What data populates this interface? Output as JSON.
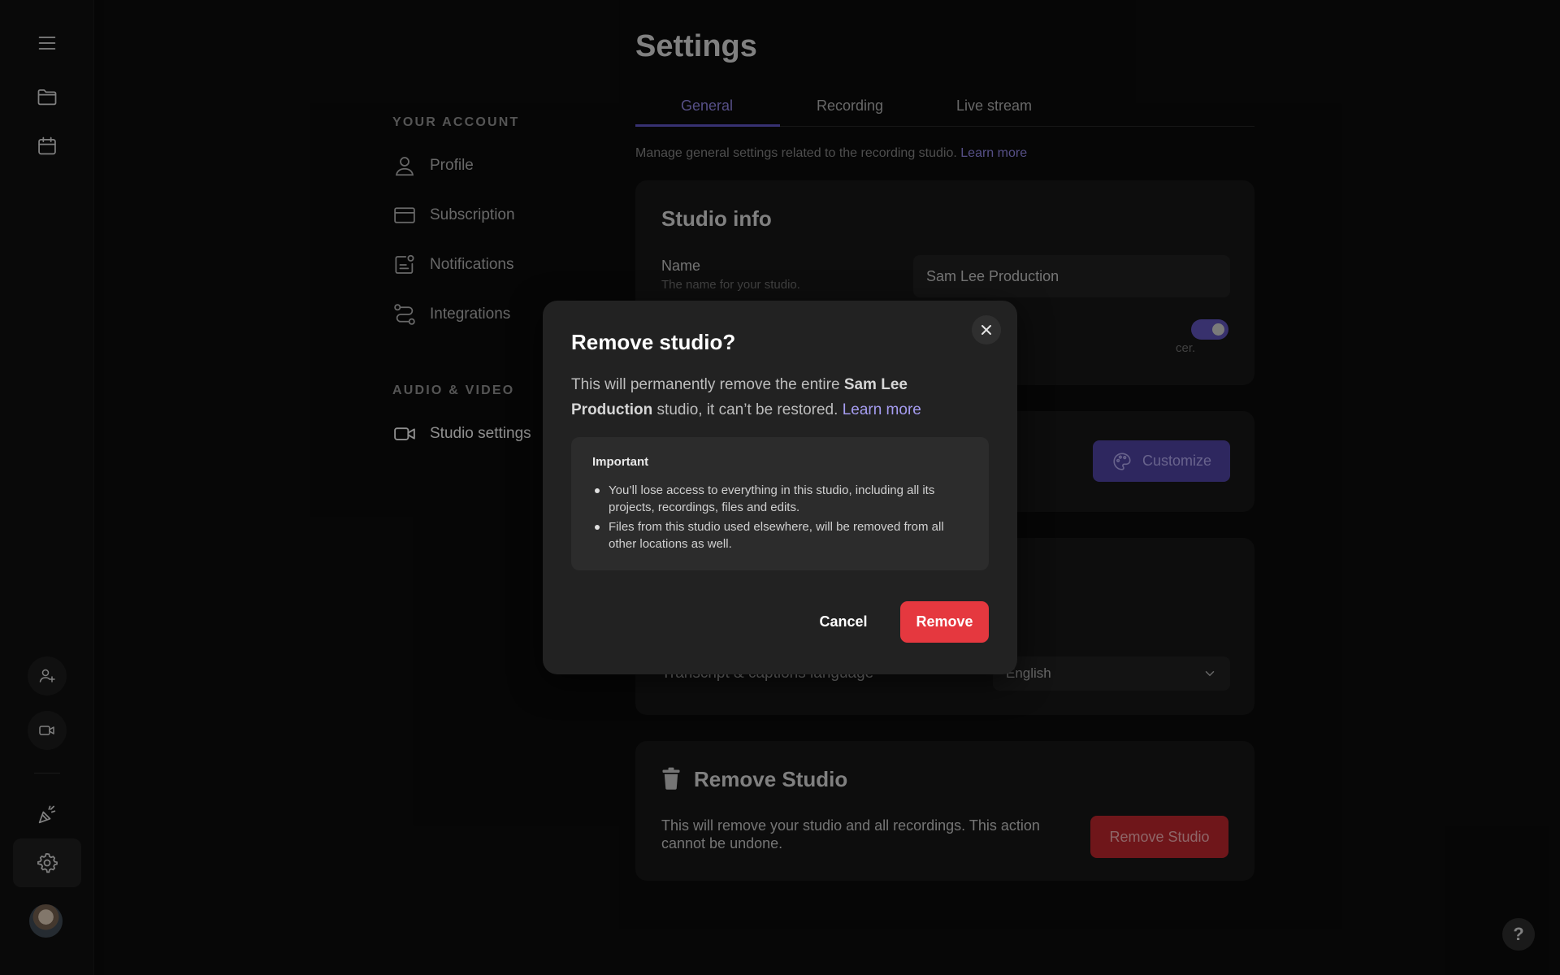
{
  "rail": {
    "icons": [
      "menu-icon",
      "folder-icon",
      "calendar-icon",
      "add-user-icon",
      "video-camera-icon",
      "celebration-icon",
      "gear-icon"
    ]
  },
  "sidebar": {
    "account_heading": "YOUR ACCOUNT",
    "account_items": [
      {
        "label": "Profile",
        "icon": "user-icon"
      },
      {
        "label": "Subscription",
        "icon": "credit-card-icon"
      },
      {
        "label": "Notifications",
        "icon": "notification-icon"
      },
      {
        "label": "Integrations",
        "icon": "integrations-icon"
      }
    ],
    "av_heading": "AUDIO & VIDEO",
    "av_items": [
      {
        "label": "Studio settings",
        "icon": "video-camera-icon"
      }
    ]
  },
  "main": {
    "title": "Settings",
    "tabs": [
      {
        "label": "General",
        "active": true
      },
      {
        "label": "Recording",
        "active": false
      },
      {
        "label": "Live stream",
        "active": false
      }
    ],
    "tab_description": "Manage general settings related to the recording studio.",
    "tab_description_link": "Learn more",
    "studio_info": {
      "title": "Studio info",
      "name_label": "Name",
      "name_sub": "The name for your studio.",
      "name_value": "Sam Lee Production",
      "toggle_sub_partial": "cer.",
      "toggle_on": true
    },
    "customize_label": "Customize",
    "language": {
      "label": "Transcript & captions language",
      "value": "English"
    },
    "remove_section": {
      "title": "Remove Studio",
      "description": "This will remove your studio and all recordings. This action cannot be undone.",
      "button": "Remove Studio"
    }
  },
  "help_label": "?",
  "modal": {
    "title": "Remove studio?",
    "body_before": "This will permanently remove the entire ",
    "body_bold": "Sam Lee Production",
    "body_after": " studio, it can’t be restored. ",
    "body_link": "Learn more",
    "important_title": "Important",
    "important_items": [
      "You’ll lose access to everything in this studio, including all its projects, recordings, files and edits.",
      "Files from this studio used elsewhere, will be removed from all other locations as well."
    ],
    "cancel_label": "Cancel",
    "remove_label": "Remove"
  },
  "colors": {
    "accent": "#5a4fb8",
    "danger": "#e5383f"
  }
}
